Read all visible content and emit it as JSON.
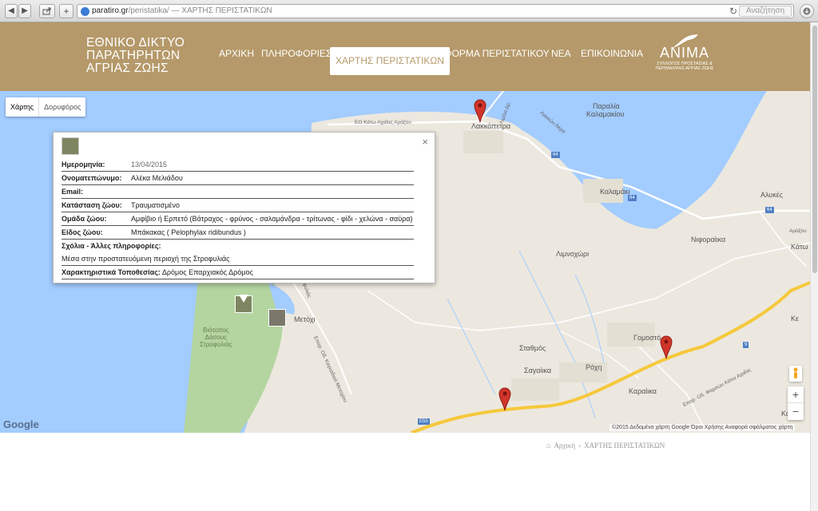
{
  "browser": {
    "url_host": "paratiro.gr",
    "url_path": "/peristatika/",
    "url_title": " — ΧΑΡΤΗΣ ΠΕΡΙΣΤΑΤΙΚΩΝ",
    "search_label": "Αναζήτηση",
    "back": "◀",
    "forward": "▶",
    "reload": "↻"
  },
  "site": {
    "logo_lines": [
      "ΕΘΝΙΚΟ ΔΙΚΤΥΟ",
      "ΠΑΡΑΤΗΡΗΤΩΝ",
      "ΑΓΡΙΑΣ ΖΩΗΣ"
    ],
    "nav": [
      {
        "label": "ΑΡΧΙΚΗ",
        "active": false
      },
      {
        "label": "ΠΛΗΡΟΦΟΡΙΕΣ",
        "active": false
      },
      {
        "label": "ΧΑΡΤΗΣ ΠΕΡΙΣΤΑΤΙΚΩΝ",
        "active": true
      },
      {
        "label": "ΦΟΡΜΑ ΠΕΡΙΣΤΑΤΙΚΟΥ",
        "active": false
      },
      {
        "label": "ΝΕΑ",
        "active": false
      },
      {
        "label": "ΕΠΙΚΟΙΝΩΝΙΑ",
        "active": false
      }
    ],
    "partner_name": "ANIMA",
    "partner_sub1": "ΣΥΛΛΟΓΟΣ ΠΡΟΣΤΑΣΙΑΣ &",
    "partner_sub2": "ΠΕΡΙΘΑΛΨΗΣ ΑΓΡΙΑΣ ΖΩΗΣ",
    "header_color": "#b5996a"
  },
  "map": {
    "type_map": "Χάρτης",
    "type_satellite": "Δορυφόρος",
    "places": {
      "lakkopetra": "Λακκόπετρα",
      "paralia_kalamakiou_1": "Παραλία",
      "paralia_kalamakiou_2": "Καλαμακίου",
      "kalamaki": "Καλαμάκι",
      "alykes": "Αλυκές",
      "nifor": "Νιφοραίικα",
      "limnoxori": "Λιμνοχώρι",
      "metochi": "Μετόχι",
      "stathmos": "Σταθμός",
      "gomosto": "Γομοστό",
      "roxi": "Ρόχη",
      "sagaiika": "Σαγαίικα",
      "karaiika": "Καραίικα",
      "kato": "Κάτω",
      "arazou": "Αράξου",
      "biotopos_1": "Βιότοπος",
      "biotopos_2": "Δάσους",
      "biotopos_3": "Στροφυλιάς",
      "ke": "Κε",
      "ko": "Κο"
    },
    "roads": {
      "eo": "ΕΟ Κάτω Αχαΐας Αράξου",
      "lakki": "Λακκών Άκρα",
      "epar_metochi": "Επαρ. Οδ. Καγκαδιού Μετοχίου",
      "epar_karaiika": "Επαρ. Οδ. Φαρσών Κάτω Αχαΐας",
      "e55": "E55",
      "r64a": "64",
      "r64b": "64",
      "r64c": "64",
      "r9": "9",
      "lakkopetra_side": "Λιμάνι Δρ.",
      "strofylia_side": "Στροφυλιάς"
    },
    "google": "Google",
    "attribution": "©2015 Δεδομένα χάρτη Google   Όροι Χρήσης   Αναφορά σφάλματος χάρτη",
    "zoom_in": "+",
    "zoom_out": "−",
    "water_color": "#a3ccff",
    "land_color": "#ece8df",
    "park_color": "#b4d5a0",
    "highway_color": "#f6c83b",
    "pin_color": "#d0352b"
  },
  "incident": {
    "close": "×",
    "fields": [
      {
        "key": "Ημερομηνία:",
        "value": "13/04/2015",
        "style": "grey"
      },
      {
        "key": "Ονοματεπώνυμο:",
        "value": "Αλέκα Μελιάδου",
        "style": "normal"
      },
      {
        "key": "Email:",
        "value": "",
        "style": "normal"
      },
      {
        "key": "Κατάσταση ζώου:",
        "value": "Τραυματισμένο",
        "style": "normal"
      },
      {
        "key": "Ομάδα ζώου:",
        "value": "Αμφίβιο ή Ερπετό (Βάτραχος - φρύνος - σαλαμάνδρα - τρίτωνας - φίδι - χελώνα - σαύρα)",
        "style": "normal"
      },
      {
        "key": "Είδος ζώου:",
        "value": "Μπάκακας ( Pelophylax ridibundus )",
        "style": "normal"
      }
    ],
    "comments_label": "Σχόλια - Άλλες πληροφορίες:",
    "comments_value": "Μέσα στην προστατευόμενη περιοχή της Στροφυλιάς",
    "location_label": "Χαρακτηριστικά Τοποθεσίας:",
    "location_value": "Δρόμος Επαρχιακός Δρόμος"
  },
  "breadcrumb": {
    "home": "Αρχική",
    "sep": "›",
    "current": "ΧΑΡΤΗΣ ΠΕΡΙΣΤΑΤΙΚΩΝ"
  }
}
